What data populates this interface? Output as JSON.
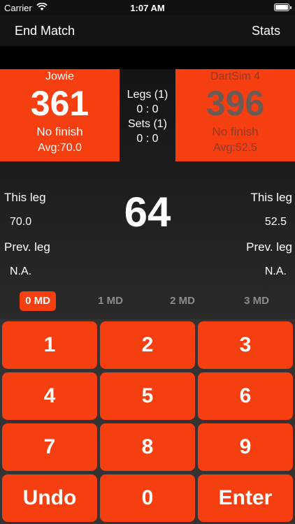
{
  "status": {
    "carrier": "Carrier",
    "time": "1:07 AM"
  },
  "nav": {
    "left": "End Match",
    "right": "Stats"
  },
  "player1": {
    "name": "Jowie",
    "score": "361",
    "finish": "No finish",
    "avg": "Avg:70.0"
  },
  "player2": {
    "name": "DartSim 4",
    "score": "396",
    "finish": "No finish",
    "avg": "Avg:52.5"
  },
  "match": {
    "legs_label": "Legs (1)",
    "legs_score": "0 : 0",
    "sets_label": "Sets (1)",
    "sets_score": "0 : 0"
  },
  "current_score": "64",
  "left_stats": {
    "this_leg_label": "This leg",
    "this_leg_value": "70.0",
    "prev_leg_label": "Prev. leg",
    "prev_leg_value": "N.A."
  },
  "right_stats": {
    "this_leg_label": "This leg",
    "this_leg_value": "52.5",
    "prev_leg_label": "Prev. leg",
    "prev_leg_value": "N.A."
  },
  "md_options": [
    "0 MD",
    "1 MD",
    "2 MD",
    "3 MD"
  ],
  "keys": [
    "1",
    "2",
    "3",
    "4",
    "5",
    "6",
    "7",
    "8",
    "9",
    "Undo",
    "0",
    "Enter"
  ],
  "colors": {
    "accent": "#f53f11",
    "background": "#141414"
  }
}
